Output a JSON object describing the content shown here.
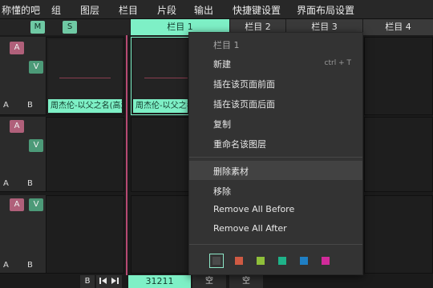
{
  "menubar": {
    "items": [
      "称懂的吧",
      "组",
      "图层",
      "栏目",
      "片段",
      "输出",
      "快捷键设置",
      "界面布局设置"
    ]
  },
  "colheader": {
    "m_label": "M",
    "s_label": "S",
    "tabs": [
      "栏目 1",
      "栏目 2",
      "栏目 3",
      "栏目 4"
    ]
  },
  "layers": {
    "a_label": "A",
    "v_label": "V",
    "ab_a": "A",
    "ab_b": "B"
  },
  "clips": {
    "clip1_title": "周杰伦-以父之名(高清)",
    "clip2_title": "周杰伦-以父之名(高清)"
  },
  "bottom": {
    "b_label": "B",
    "counter": "31211",
    "empty1": "空",
    "empty2": "空"
  },
  "context_menu": {
    "header": "栏目 1",
    "items": [
      {
        "label": "新建",
        "shortcut": "ctrl + T"
      },
      {
        "label": "插在该页面前面"
      },
      {
        "label": "插在该页面后面"
      },
      {
        "label": "复制"
      },
      {
        "label": "重命名该图层"
      },
      {
        "label": "删除素材"
      },
      {
        "label": "移除"
      },
      {
        "label": "Remove All Before"
      },
      {
        "label": "Remove All After"
      }
    ],
    "colors": [
      "#4a4a4a",
      "#cf5a43",
      "#8fbf3a",
      "#1fb389",
      "#1f7fc4",
      "#d12a9a"
    ]
  },
  "theme": {
    "accent": "#7ef0c6",
    "layer_a": "#b0607a",
    "layer_v": "#4c9a78"
  }
}
